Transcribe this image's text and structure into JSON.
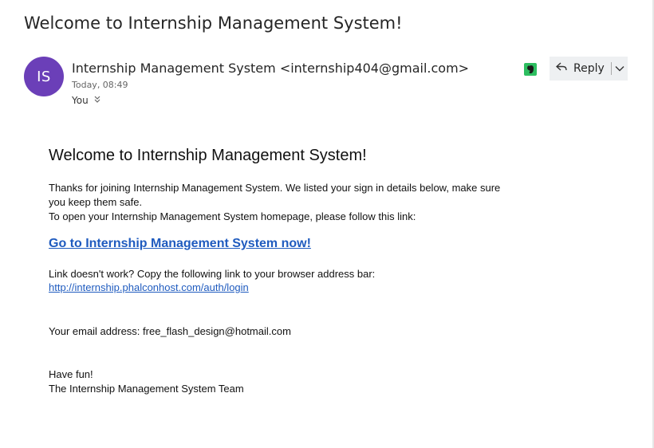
{
  "email": {
    "subject": "Welcome to Internship Management System!",
    "avatar_initials": "IS",
    "sender": "Internship Management System <internship404@gmail.com>",
    "date": "Today, 08:49",
    "recipient": "You",
    "reply_label": "Reply"
  },
  "message": {
    "heading": "Welcome to Internship Management System!",
    "intro_line1": "Thanks for joining Internship Management System. We listed your sign in details below, make sure you keep them safe.",
    "intro_line2": "To open your Internship Management System homepage, please follow this link:",
    "cta_link": "Go to Internship Management System now!",
    "fallback_text": "Link doesn't work? Copy the following link to your browser address bar:",
    "fallback_url": "http://internship.phalconhost.com/auth/login",
    "email_line": "Your email address: free_flash_design@hotmail.com",
    "signoff_line1": "Have fun!",
    "signoff_line2": "The Internship Management System Team"
  },
  "colors": {
    "avatar_bg": "#6b3fb8",
    "link": "#1f5bbf",
    "evernote": "#2dbe60",
    "reply_bg": "#eef0f2"
  },
  "icons": {
    "evernote": "evernote-icon",
    "reply": "reply-arrow-icon",
    "more": "chevron-down-icon",
    "expand": "double-chevron-down-icon"
  }
}
